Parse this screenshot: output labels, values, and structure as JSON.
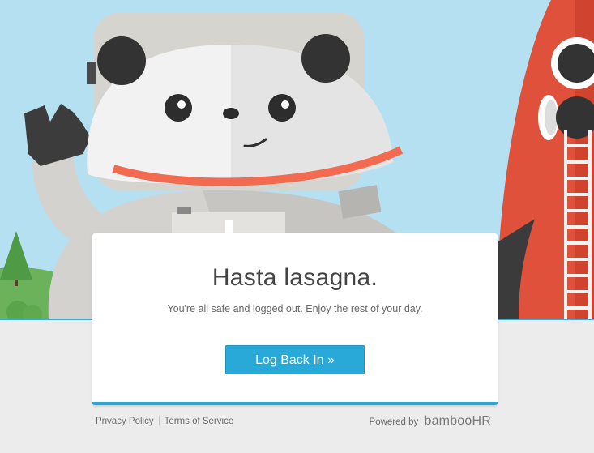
{
  "card": {
    "heading": "Hasta lasagna.",
    "message": "You're all safe and logged out. Enjoy the rest of your day.",
    "button_label": "Log Back In »"
  },
  "footer": {
    "privacy": "Privacy Policy",
    "terms": "Terms of Service",
    "powered_by": "Powered by",
    "brand": "bambooHR"
  },
  "colors": {
    "sky": "#b5e0f2",
    "accent": "#29a9d8",
    "rocket": "#e0513c",
    "page_bg": "#ececec"
  }
}
